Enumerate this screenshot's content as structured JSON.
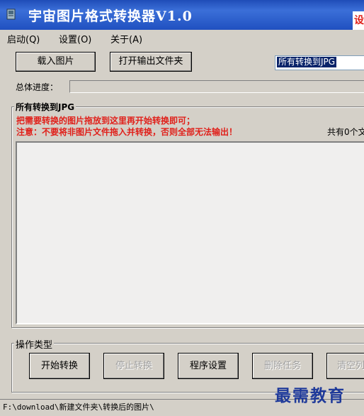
{
  "window": {
    "title": "宇宙图片格式转换器V1.0",
    "ad_badge": "设"
  },
  "menu": {
    "items": [
      {
        "label": "启动(Q)"
      },
      {
        "label": "设置(O)"
      },
      {
        "label": "关于(A)"
      }
    ]
  },
  "toolbar": {
    "load_label": "载入图片",
    "open_output_label": "打开输出文件夹",
    "format_select_value": "所有转换到JPG"
  },
  "progress": {
    "label": "总体进度：",
    "value": 0
  },
  "file_group": {
    "legend": "所有转换到JPG",
    "hint_line1": "把需要转换的图片拖放到这里再开始转换即可；",
    "hint_line2": "注意：不要将非图片文件拖入并转换，否则全部无法输出！",
    "count_label": "共有0个文"
  },
  "actions": {
    "legend": "操作类型",
    "start_label": "开始转换",
    "stop_label": "停止转换",
    "settings_label": "程序设置",
    "delete_label": "删除任务",
    "clear_label": "清空列"
  },
  "status": {
    "path": "F:\\download\\新建文件夹\\转换后的图片\\"
  },
  "watermark": {
    "text": "最需教育"
  },
  "colors": {
    "titlebar": "#2050c0",
    "hint_red": "#e0201a",
    "window_face": "#d4d0c8"
  }
}
